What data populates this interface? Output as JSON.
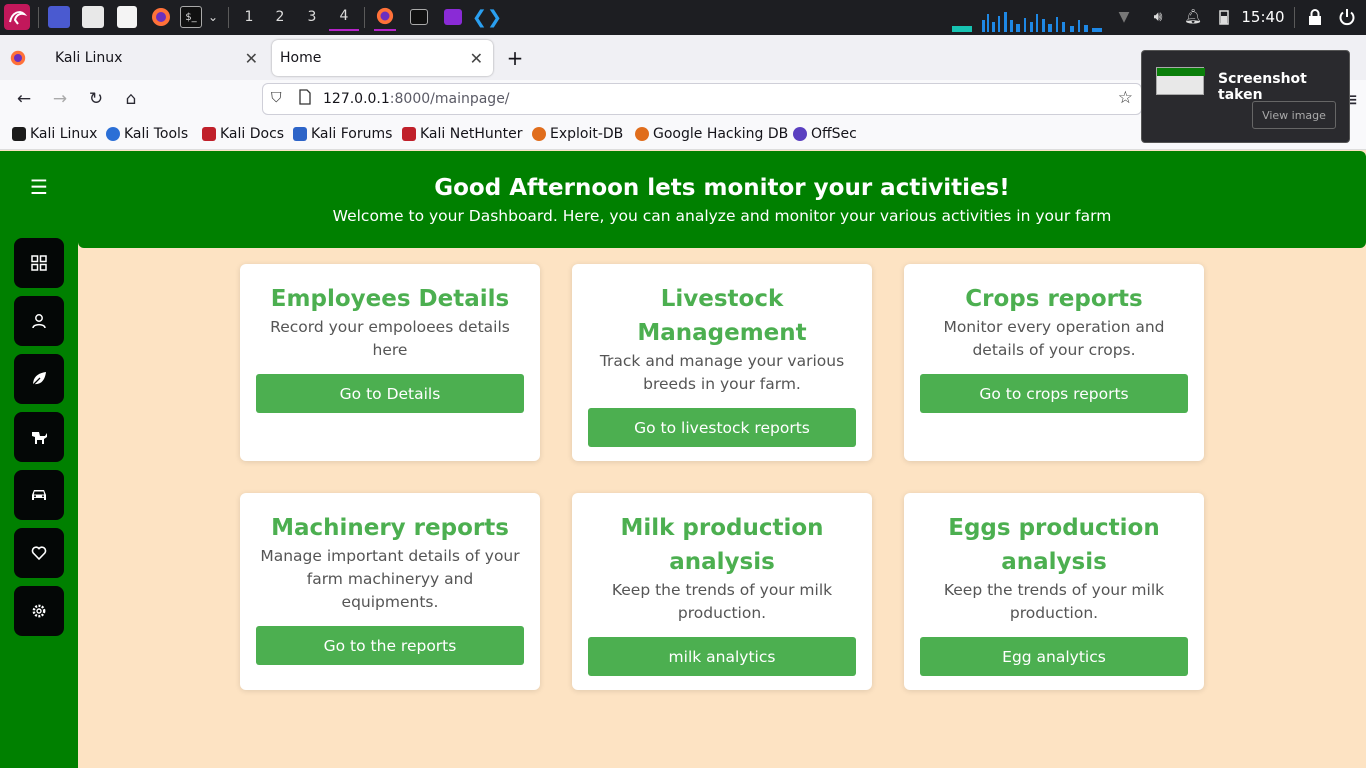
{
  "taskbar": {
    "workspaces": [
      "1",
      "2",
      "3",
      "4"
    ],
    "active_workspace": "4",
    "clock": "15:40"
  },
  "browser": {
    "tabs": [
      {
        "label": "Kali Linux"
      },
      {
        "label": "Home"
      }
    ],
    "url_host": "127.0.0.1",
    "url_path": ":8000/mainpage/",
    "bookmarks": [
      {
        "label": "Kali Linux",
        "color": "#1b1b1b"
      },
      {
        "label": "Kali Tools",
        "color": "#2b6fd6"
      },
      {
        "label": "Kali Docs",
        "color": "#c0202a"
      },
      {
        "label": "Kali Forums",
        "color": "#2d64c8"
      },
      {
        "label": "Kali NetHunter",
        "color": "#c0202a"
      },
      {
        "label": "Exploit-DB",
        "color": "#e06d1c"
      },
      {
        "label": "Google Hacking DB",
        "color": "#e06d1c"
      },
      {
        "label": "OffSec",
        "color": "#5a3fc0"
      }
    ]
  },
  "notification": {
    "title": "Screenshot taken",
    "button": "View image"
  },
  "header": {
    "title": "Good Afternoon lets monitor your activities!",
    "subtitle": "Welcome to your Dashboard. Here, you can analyze and monitor your various activities in your farm"
  },
  "cards": [
    {
      "title": "Employees Details",
      "desc": "Record your empoloees details here",
      "button": "Go to Details"
    },
    {
      "title": "Livestock Management",
      "desc": "Track and manage your various breeds in your farm.",
      "button": "Go to livestock reports"
    },
    {
      "title": "Crops reports",
      "desc": "Monitor every operation and details of your crops.",
      "button": "Go to crops reports"
    },
    {
      "title": "Machinery reports",
      "desc": "Manage important details of your farm machineryy and equipments.",
      "button": "Go to the reports"
    },
    {
      "title": "Milk production analysis",
      "desc": "Keep the trends of your milk production.",
      "button": "milk analytics"
    },
    {
      "title": "Eggs production analysis",
      "desc": "Keep the trends of your milk production.",
      "button": "Egg analytics"
    }
  ],
  "sidebar_icons": [
    "dashboard-icon",
    "user-icon",
    "leaf-icon",
    "livestock-icon",
    "car-icon",
    "heart-icon",
    "gear-icon"
  ],
  "colors": {
    "sidebar_green": "#008000",
    "card_green": "#4caf50",
    "page_bg": "#fde3c3",
    "sidebar_button": "#040706"
  }
}
